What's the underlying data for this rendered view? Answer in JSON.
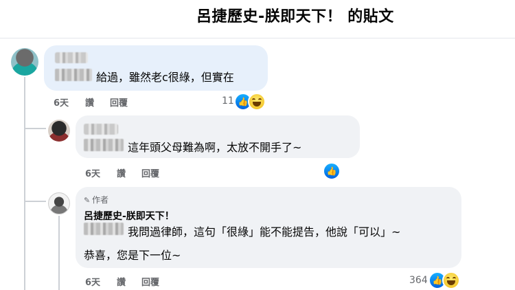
{
  "header": {
    "title": "呂捷歷史-朕即天下！ 的貼文"
  },
  "comments": [
    {
      "text": "給過，雖然老c很綠，但實在",
      "time": "6天",
      "read": "讚",
      "reply": "回覆",
      "reaction_count": "11",
      "reactions": [
        "like-icon",
        "haha-icon"
      ]
    },
    {
      "text": "這年頭父母難為啊，太放不開手了~",
      "time": "6天",
      "read": "讚",
      "reply": "回覆",
      "reactions": [
        "like-icon"
      ]
    },
    {
      "author_badge": "作者",
      "name": "呂捷歷史-朕即天下！",
      "text_line1": "我問過律師，這句「很綠」能不能提告，他說「可以」~",
      "text_line2": "恭喜，您是下一位~",
      "time": "6天",
      "read": "讚",
      "reply": "回覆",
      "reaction_count": "364",
      "reactions": [
        "like-icon",
        "haha-icon"
      ]
    }
  ],
  "colors": {
    "like_blue": "#0866ff",
    "bubble_gray": "#f0f2f5",
    "bubble_highlight": "#e7f0fb",
    "meta_gray": "#65676b"
  }
}
